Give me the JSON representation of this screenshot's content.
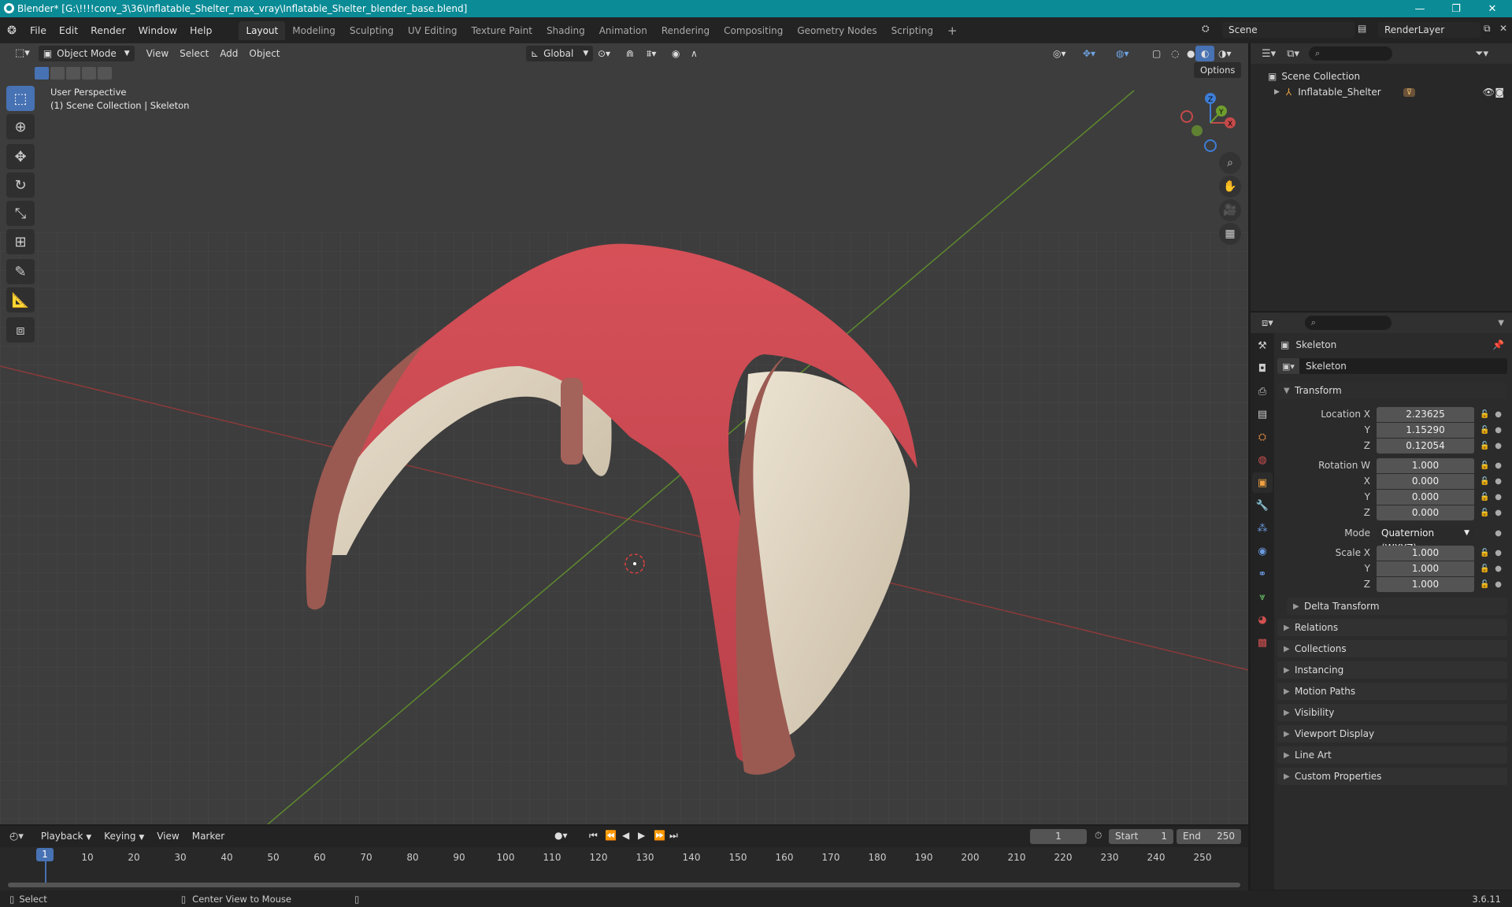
{
  "window": {
    "title": "Blender* [G:\\!!!!conv_3\\36\\Inflatable_Shelter_max_vray\\Inflatable_Shelter_blender_base.blend]",
    "minimize": "—",
    "maximize": "❐",
    "close": "✕"
  },
  "menubar": {
    "items": [
      "File",
      "Edit",
      "Render",
      "Window",
      "Help"
    ]
  },
  "workspaces": {
    "tabs": [
      "Layout",
      "Modeling",
      "Sculpting",
      "UV Editing",
      "Texture Paint",
      "Shading",
      "Animation",
      "Rendering",
      "Compositing",
      "Geometry Nodes",
      "Scripting"
    ],
    "add": "+"
  },
  "scene": {
    "name": "Scene",
    "render_layer": "RenderLayer"
  },
  "viewport": {
    "mode": "Object Mode",
    "menus": [
      "View",
      "Select",
      "Add",
      "Object"
    ],
    "orientation": "Global",
    "options": "Options",
    "info_line1": "User Perspective",
    "info_line2": "(1) Scene Collection | Skeleton",
    "gizmo": {
      "x": "X",
      "y": "Y",
      "z": "Z"
    }
  },
  "outliner": {
    "root": "Scene Collection",
    "items": [
      {
        "name": "Inflatable_Shelter"
      }
    ]
  },
  "properties": {
    "object_name": "Skeleton",
    "datablock_name": "Skeleton",
    "transform_title": "Transform",
    "location": {
      "label_x": "Location X",
      "label_y": "Y",
      "label_z": "Z",
      "x": "2.23625",
      "y": "1.15290",
      "z": "0.12054"
    },
    "rotation": {
      "label_w": "Rotation W",
      "label_x": "X",
      "label_y": "Y",
      "label_z": "Z",
      "w": "1.000",
      "x": "0.000",
      "y": "0.000",
      "z": "0.000"
    },
    "mode": {
      "label": "Mode",
      "value": "Quaternion (WXYZ)"
    },
    "scale": {
      "label_x": "Scale X",
      "label_y": "Y",
      "label_z": "Z",
      "x": "1.000",
      "y": "1.000",
      "z": "1.000"
    },
    "delta_transform": "Delta Transform",
    "panels": [
      "Relations",
      "Collections",
      "Instancing",
      "Motion Paths",
      "Visibility",
      "Viewport Display",
      "Line Art",
      "Custom Properties"
    ]
  },
  "timeline": {
    "menus": [
      "Playback",
      "Keying",
      "View",
      "Marker"
    ],
    "current_frame": "1",
    "start_label": "Start",
    "start": "1",
    "end_label": "End",
    "end": "250",
    "ruler": [
      "10",
      "20",
      "30",
      "40",
      "50",
      "60",
      "70",
      "80",
      "90",
      "100",
      "110",
      "120",
      "130",
      "140",
      "150",
      "160",
      "170",
      "180",
      "190",
      "200",
      "210",
      "220",
      "230",
      "240",
      "250"
    ],
    "playhead": "1"
  },
  "statusbar": {
    "select": "Select",
    "center_view": "Center View to Mouse",
    "version": "3.6.11"
  },
  "colors": {
    "accent": "#4772b3",
    "titlebar": "#0a8b96",
    "tent_red": "#c94850",
    "tent_cream": "#d8cfbd",
    "frame_brown": "#9a5a52"
  }
}
